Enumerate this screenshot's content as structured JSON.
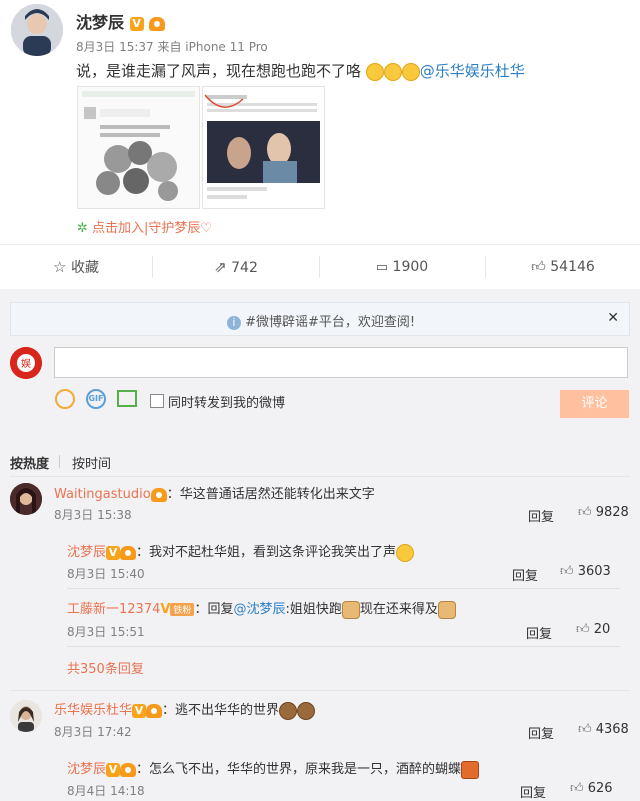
{
  "post": {
    "author": "沈梦辰",
    "meta": "8月3日 15:37 来自 iPhone 11 Pro",
    "text": "说，是谁走漏了风声，现在想跑也跑不了咯",
    "mention": "@乐华娱乐杜华",
    "fan_link": "点击加入|守护梦辰♡"
  },
  "actions": {
    "favorite": "收藏",
    "repost_count": "742",
    "comment_count": "1900",
    "like_count": "54146"
  },
  "notice": "#微博辟谣#平台，欢迎查阅!",
  "composer": {
    "placeholder": "",
    "checkbox_label": "同时转发到我的微博",
    "submit": "评论",
    "gif_label": "GIF"
  },
  "sort": {
    "hot": "按热度",
    "time": "按时间"
  },
  "comments": [
    {
      "name": "Waitingastudio",
      "text": "：华这普通话居然还能转化出来文字",
      "time": "8月3日 15:38",
      "reply": "回复",
      "likes": "9828"
    },
    {
      "name": "沈梦辰",
      "text": "：我对不起杜华姐，看到这条评论我笑出了声",
      "time": "8月3日 15:40",
      "reply": "回复",
      "likes": "3603"
    },
    {
      "name": "工藤新一12374",
      "badge": "铁粉",
      "text_pre": "：回复",
      "mention": "@沈梦辰",
      "text": ":姐姐快跑",
      "text2": "现在还来得及",
      "time": "8月3日 15:51",
      "reply": "回复",
      "likes": "20"
    },
    {
      "more": "共350条回复"
    },
    {
      "name": "乐华娱乐杜华",
      "text": "：逃不出华华的世界",
      "time": "8月3日 17:42",
      "reply": "回复",
      "likes": "4368"
    },
    {
      "name": "沈梦辰",
      "text": "：怎么飞不出，华华的世界，原来我是一只，酒醉的蝴蝶",
      "time": "8月4日 14:18",
      "reply": "回复",
      "likes": "626"
    }
  ]
}
